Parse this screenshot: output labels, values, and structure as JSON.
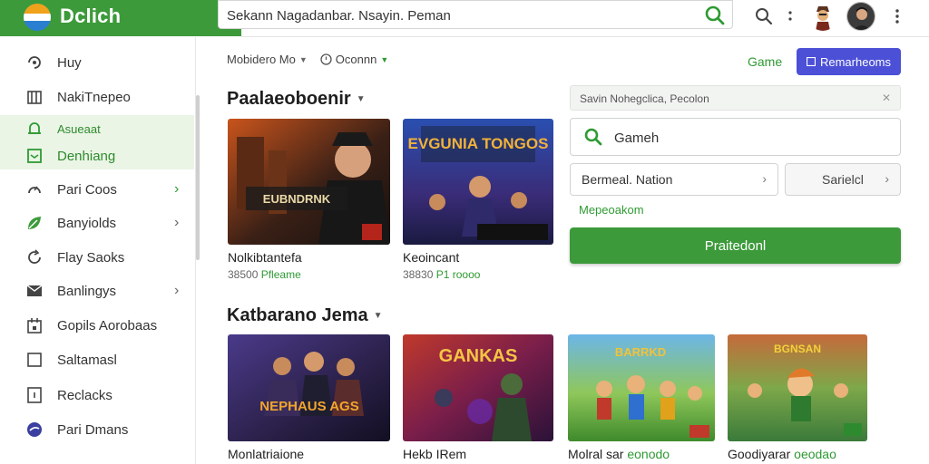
{
  "app": {
    "brand_name": "Dclich"
  },
  "header": {
    "search_value": "Sekann Nagadanbar. Nsayin. Peman",
    "icons": [
      "search-icon",
      "more-vert-icon",
      "avatar-character",
      "avatar-profile",
      "more-vert-icon"
    ]
  },
  "sidebar": {
    "items": [
      {
        "label": "Huy",
        "icon": "puzzle-icon",
        "chevron": false,
        "active": false
      },
      {
        "label": "NakiTnepeo",
        "icon": "library-icon",
        "chevron": false,
        "active": false
      },
      {
        "label": "Asueaat",
        "icon": "bell-icon",
        "chevron": false,
        "active": true,
        "small": true
      },
      {
        "label": "Denhiang",
        "icon": "inbox-icon",
        "chevron": false,
        "active": true
      },
      {
        "label": "Pari Coos",
        "icon": "gauge-icon",
        "chevron": true,
        "active": false
      },
      {
        "label": "Banyiolds",
        "icon": "leaf-icon",
        "chevron": true,
        "active": false
      },
      {
        "label": "Flay Saoks",
        "icon": "refresh-icon",
        "chevron": false,
        "active": false
      },
      {
        "label": "Banlingys",
        "icon": "mail-icon",
        "chevron": true,
        "active": false
      },
      {
        "label": "Gopils Aorobaas",
        "icon": "calendar-icon",
        "chevron": false,
        "active": false
      },
      {
        "label": "Saltamasl",
        "icon": "square-icon",
        "chevron": false,
        "active": false
      },
      {
        "label": "Reclacks",
        "icon": "tag-icon",
        "chevron": false,
        "active": false
      },
      {
        "label": "Pari Dmans",
        "icon": "shield-icon",
        "chevron": false,
        "active": false
      }
    ]
  },
  "filters": [
    {
      "label": "Mobidero Mo"
    },
    {
      "label": "Oconnn",
      "icon": "globe-icon"
    }
  ],
  "section1": {
    "title": "Paalaeoboenir",
    "cards": [
      {
        "title": "Nolkibtantefa",
        "meta_a": "38500",
        "meta_b": "Pfleame",
        "thumb_text": "EUBNDRNK"
      },
      {
        "title": "Keoincant",
        "meta_a": "38830",
        "meta_b": "P1 roooo",
        "thumb_text": "EVGUNIA TONGOS"
      }
    ]
  },
  "section2": {
    "title": "Katbarano Jema",
    "cards": [
      {
        "title": "Monlatriaione",
        "thumb_text": "NEPHAUS AGS"
      },
      {
        "title": "Hekb IRem",
        "thumb_text": "GANKAS"
      },
      {
        "title": "Molral sar",
        "title_green": "eonodo",
        "thumb_text": "BARRKD"
      },
      {
        "title": "Goodiyarar",
        "title_green": "oeodao",
        "thumb_text": "BGNSAN"
      }
    ]
  },
  "right_panel": {
    "game_link": "Game",
    "primary_button": "Remarheoms",
    "head_text": "Savin  Nohegclica, Pecolon",
    "search_value": "Gameh",
    "select_left": "Bermeal. Nation",
    "select_right": "Sarielcl",
    "green_link": "Mepeoakom",
    "green_button": "Praitedonl"
  },
  "colors": {
    "brand_green": "#3c9a3a",
    "accent_purple": "#4b50d6",
    "link_green": "#2f9a33"
  }
}
